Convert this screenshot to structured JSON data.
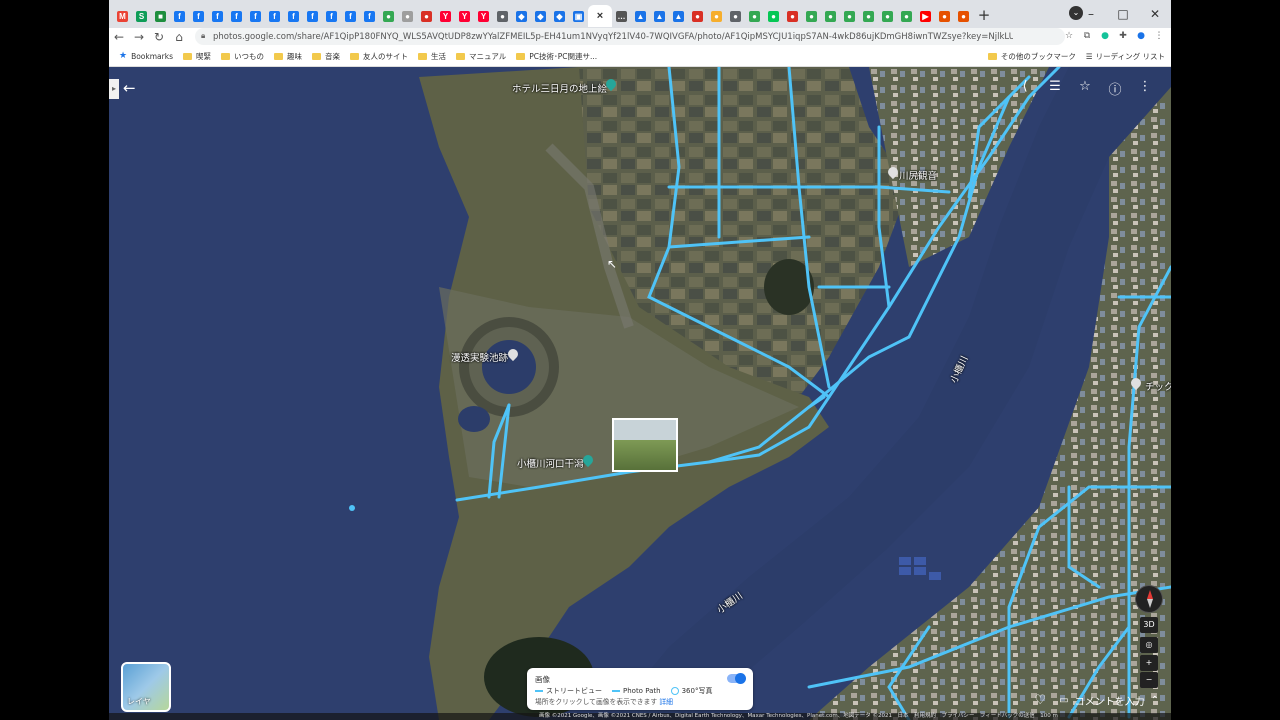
{
  "browser": {
    "tabs": [
      {
        "icon": "gmail-icon",
        "color": "#ea4335",
        "glyph": "M"
      },
      {
        "icon": "sheets-icon",
        "color": "#0f9d58",
        "glyph": "S"
      },
      {
        "icon": "app-icon",
        "color": "#1e8e3e",
        "glyph": "■"
      },
      {
        "icon": "facebook-icon",
        "color": "#1877f2",
        "glyph": "f"
      },
      {
        "icon": "facebook-icon",
        "color": "#1877f2",
        "glyph": "f"
      },
      {
        "icon": "facebook-icon",
        "color": "#1877f2",
        "glyph": "f"
      },
      {
        "icon": "facebook-icon",
        "color": "#1877f2",
        "glyph": "f"
      },
      {
        "icon": "facebook-icon",
        "color": "#1877f2",
        "glyph": "f"
      },
      {
        "icon": "facebook-icon",
        "color": "#1877f2",
        "glyph": "f"
      },
      {
        "icon": "facebook-icon",
        "color": "#1877f2",
        "glyph": "f"
      },
      {
        "icon": "facebook-icon",
        "color": "#1877f2",
        "glyph": "f"
      },
      {
        "icon": "facebook-icon",
        "color": "#1877f2",
        "glyph": "f"
      },
      {
        "icon": "facebook-icon",
        "color": "#1877f2",
        "glyph": "f"
      },
      {
        "icon": "facebook-icon",
        "color": "#1877f2",
        "glyph": "f"
      },
      {
        "icon": "maps-pin-icon",
        "color": "#34a853",
        "glyph": "●"
      },
      {
        "icon": "app-icon",
        "color": "#9e9e9e",
        "glyph": "●"
      },
      {
        "icon": "app-icon",
        "color": "#d93025",
        "glyph": "●"
      },
      {
        "icon": "yahoo-icon",
        "color": "#ff0033",
        "glyph": "Y"
      },
      {
        "icon": "yahoo-icon",
        "color": "#ff0033",
        "glyph": "Y"
      },
      {
        "icon": "yahoo-icon",
        "color": "#ff0033",
        "glyph": "Y"
      },
      {
        "icon": "app-icon",
        "color": "#5f6368",
        "glyph": "●"
      },
      {
        "icon": "cube-icon",
        "color": "#1a73e8",
        "glyph": "◆"
      },
      {
        "icon": "cube-icon",
        "color": "#1a73e8",
        "glyph": "◆"
      },
      {
        "icon": "cube-icon",
        "color": "#1a73e8",
        "glyph": "◆"
      },
      {
        "icon": "photos-icon",
        "color": "#1a73e8",
        "glyph": "▣"
      },
      {
        "icon": "close-icon",
        "color": "#333333",
        "glyph": "×",
        "active": true
      },
      {
        "icon": "more-icon",
        "color": "#555555",
        "glyph": "…"
      },
      {
        "icon": "translate-icon",
        "color": "#1a73e8",
        "glyph": "▲"
      },
      {
        "icon": "translate-icon",
        "color": "#1a73e8",
        "glyph": "▲"
      },
      {
        "icon": "translate-icon",
        "color": "#1a73e8",
        "glyph": "▲"
      },
      {
        "icon": "app-icon",
        "color": "#d93025",
        "glyph": "●"
      },
      {
        "icon": "app-icon",
        "color": "#f6ae2d",
        "glyph": "●"
      },
      {
        "icon": "app-icon",
        "color": "#5f6368",
        "glyph": "●"
      },
      {
        "icon": "maps-pin-icon",
        "color": "#34a853",
        "glyph": "●"
      },
      {
        "icon": "line-icon",
        "color": "#06c755",
        "glyph": "●"
      },
      {
        "icon": "app-icon",
        "color": "#d93025",
        "glyph": "●"
      },
      {
        "icon": "maps-pin-icon",
        "color": "#34a853",
        "glyph": "●"
      },
      {
        "icon": "maps-pin-icon",
        "color": "#34a853",
        "glyph": "●"
      },
      {
        "icon": "maps-pin-icon",
        "color": "#34a853",
        "glyph": "●"
      },
      {
        "icon": "maps-pin-icon",
        "color": "#34a853",
        "glyph": "●"
      },
      {
        "icon": "maps-pin-icon",
        "color": "#34a853",
        "glyph": "●"
      },
      {
        "icon": "maps-pin-icon",
        "color": "#34a853",
        "glyph": "●"
      },
      {
        "icon": "youtube-icon",
        "color": "#ff0000",
        "glyph": "▶"
      },
      {
        "icon": "app-icon",
        "color": "#e65100",
        "glyph": "●"
      },
      {
        "icon": "app-icon",
        "color": "#e65100",
        "glyph": "●"
      }
    ],
    "new_tab": "+",
    "window_controls": {
      "minimize": "–",
      "maximize": "□",
      "close": "✕"
    },
    "address": "photos.google.com/share/AF1QipP180FNYQ_WLS5AVQtUDP8zwYYalZFMEIL5p-EH41um1NVyqYf21lV40-7WQIVGFA/photo/AF1QipMSYCJU1iqpS7AN-4wkD86ujKDmGH8iwnTWZsye?key=NjlkLURYOGFaSjZ5QnZUOG...",
    "bookmarks": [
      {
        "label": "Bookmarks",
        "type": "star"
      },
      {
        "label": "喫緊",
        "type": "folder"
      },
      {
        "label": "いつもの",
        "type": "folder"
      },
      {
        "label": "趣味",
        "type": "folder"
      },
      {
        "label": "音楽",
        "type": "folder"
      },
      {
        "label": "友人のサイト",
        "type": "folder"
      },
      {
        "label": "生活",
        "type": "folder"
      },
      {
        "label": "マニュアル",
        "type": "folder"
      },
      {
        "label": "PC技術･PC関連サ...",
        "type": "folder"
      }
    ],
    "bookmarks_right": {
      "other": "その他のブックマーク",
      "reading": "リーディング リスト"
    }
  },
  "map": {
    "labels": {
      "hotel": "ホテル三日月の地上絵",
      "kawajiri": "川尻観音",
      "experiment_pond": "漫透実験池跡",
      "estuary": "小櫃川河口干潟",
      "river1": "小櫃川",
      "river2": "小櫃川",
      "right_edge": "チック"
    },
    "control_3d": "3D",
    "zoom_in": "+",
    "zoom_out": "−",
    "layer_label": "レイヤ",
    "comment_label": "コメントを入力",
    "legend": {
      "title": "画像",
      "street_view": "ストリートビュー",
      "photo_path": "Photo Path",
      "photo_360": "360°写真",
      "hint": "場所をクリックして画像を表示できます",
      "hint_link": "詳細"
    },
    "footer": "画像 ©2021 Google、画像 ©2021 CNES / Airbus、Digital Earth Technology、Maxar Technologies、Planet.com、地図データ ©2021　日本　利用規約　プライバシー　フィードバックの送信　100 m",
    "colors": {
      "route": "#4fc3f7",
      "water": "#2e3f6e",
      "land": "#5e6147"
    }
  }
}
